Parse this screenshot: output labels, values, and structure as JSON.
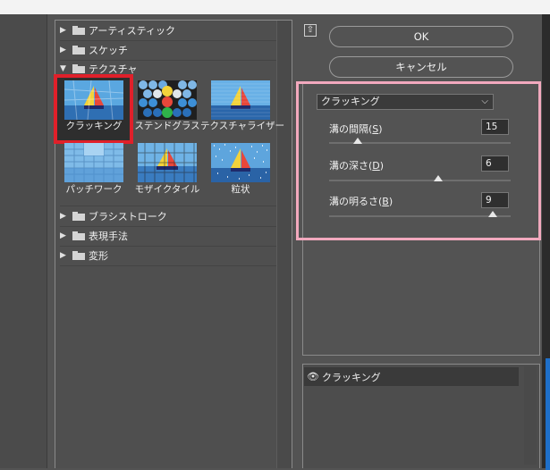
{
  "gallery": {
    "categories_top": [
      {
        "label": "アーティスティック",
        "expanded": false
      },
      {
        "label": "スケッチ",
        "expanded": false
      },
      {
        "label": "テクスチャ",
        "expanded": true
      }
    ],
    "filters": [
      {
        "label": "クラッキング",
        "selected": true
      },
      {
        "label": "ステンドグラス",
        "selected": false
      },
      {
        "label": "テクスチャライザー",
        "selected": false
      },
      {
        "label": "パッチワーク",
        "selected": false
      },
      {
        "label": "モザイクタイル",
        "selected": false
      },
      {
        "label": "粒状",
        "selected": false
      }
    ],
    "categories_bottom": [
      {
        "label": "ブラシストローク",
        "expanded": false
      },
      {
        "label": "表現手法",
        "expanded": false
      },
      {
        "label": "変形",
        "expanded": false
      }
    ]
  },
  "buttons": {
    "ok": "OK",
    "cancel": "キャンセル"
  },
  "settings": {
    "filter_select": "クラッキング",
    "params": [
      {
        "label": "溝の間隔",
        "key": "S",
        "value": "15",
        "level": 0.16
      },
      {
        "label": "溝の深さ",
        "key": "D",
        "value": "6",
        "level": 0.6
      },
      {
        "label": "溝の明るさ",
        "key": "B",
        "value": "9",
        "level": 0.9
      }
    ]
  },
  "layers": [
    {
      "label": "クラッキング",
      "visible": true
    }
  ],
  "colors": {
    "highlight_selected": "#e0202a",
    "callout_frame": "#f2a9be",
    "panel_bg": "#535353"
  }
}
